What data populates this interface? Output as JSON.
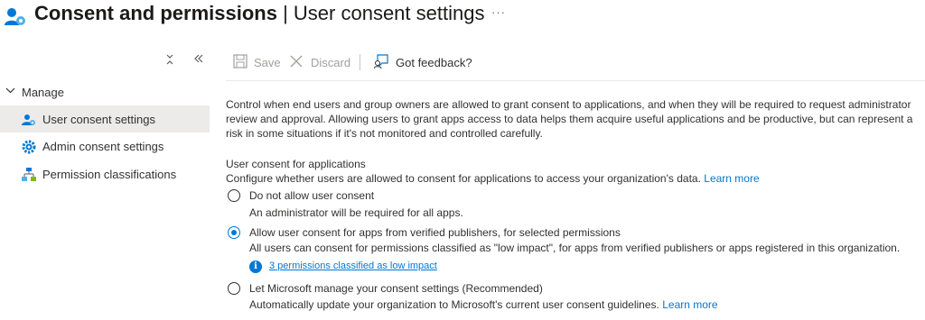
{
  "header": {
    "title_main": "Consent and permissions",
    "title_separator": " | ",
    "title_sub": "User consent settings",
    "more_label": "···"
  },
  "sidebar": {
    "collapse_icon": "collapse-icon",
    "double_chevron_icon": "double-chevron-left-icon",
    "group_label": "Manage",
    "items": [
      {
        "label": "User consent settings",
        "icon": "user-gear-icon",
        "selected": true
      },
      {
        "label": "Admin consent settings",
        "icon": "gear-icon",
        "selected": false
      },
      {
        "label": "Permission classifications",
        "icon": "hierarchy-icon",
        "selected": false
      }
    ]
  },
  "toolbar": {
    "save_label": "Save",
    "discard_label": "Discard",
    "feedback_label": "Got feedback?"
  },
  "content": {
    "intro": "Control when end users and group owners are allowed to grant consent to applications, and when they will be required to request administrator review and approval. Allowing users to grant apps access to data helps them acquire useful applications and be productive, but can represent a risk in some situations if it's not monitored and controlled carefully.",
    "section_title": "User consent for applications",
    "section_desc": "Configure whether users are allowed to consent for applications to access your organization's data.",
    "learn_more": "Learn more",
    "options": [
      {
        "label": "Do not allow user consent",
        "desc": "An administrator will be required for all apps.",
        "checked": false
      },
      {
        "label": "Allow user consent for apps from verified publishers, for selected permissions",
        "desc": "All users can consent for permissions classified as \"low impact\", for apps from verified publishers or apps registered in this organization.",
        "checked": true
      },
      {
        "label": "Let Microsoft manage your consent settings (Recommended)",
        "desc": "Automatically update your organization to Microsoft's current user consent guidelines.",
        "checked": false
      }
    ],
    "info_icon_glyph": "i",
    "impact_link": "3 permissions classified as low impact"
  },
  "colors": {
    "accent": "#0078d4",
    "selected_bg": "#edebe9",
    "disabled_text": "#a19f9d"
  }
}
